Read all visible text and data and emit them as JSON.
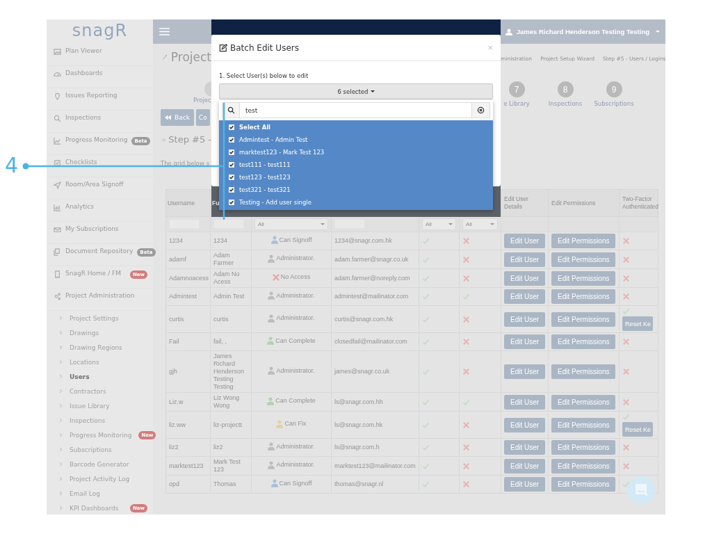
{
  "callout": {
    "label": "4"
  },
  "sidebar": {
    "logo": "snagR",
    "items": [
      {
        "label": "Plan Viewer"
      },
      {
        "label": "Dashboards"
      },
      {
        "label": "Issues Reporting"
      },
      {
        "label": "Inspections"
      },
      {
        "label": "Progress Monitoring",
        "badge": {
          "text": "Beta",
          "color": "#9c9c9c"
        }
      },
      {
        "label": "Checklists"
      },
      {
        "label": "Room/Area Signoff"
      },
      {
        "label": "Analytics"
      },
      {
        "label": "My Subscriptions"
      },
      {
        "label": "Document Repository",
        "badge": {
          "text": "Beta",
          "color": "#9c9c9c"
        }
      },
      {
        "label": "SnagR Home / FM",
        "badge": {
          "text": "New",
          "color": "#d27c7c"
        }
      },
      {
        "label": "Project Administration",
        "children": [
          {
            "label": "Project Settings",
            "selected": false
          },
          {
            "label": "Drawings",
            "selected": false
          },
          {
            "label": "Drawing Regions",
            "selected": false
          },
          {
            "label": "Locations",
            "selected": false
          },
          {
            "label": "Users",
            "selected": true
          },
          {
            "label": "Contractors",
            "selected": false
          },
          {
            "label": "Issue Library",
            "selected": false
          },
          {
            "label": "Inspections",
            "selected": false
          },
          {
            "label": "Progress Monitoring",
            "selected": false,
            "badge": {
              "text": "New",
              "color": "#d27c7c"
            }
          },
          {
            "label": "Subscriptions",
            "selected": false
          },
          {
            "label": "Barcode Generator",
            "selected": false
          },
          {
            "label": "Project Activity Log",
            "selected": false
          },
          {
            "label": "Email Log",
            "selected": false
          },
          {
            "label": "KPI Dashboards",
            "selected": false,
            "badge": {
              "text": "New",
              "color": "#d27c7c"
            }
          }
        ]
      }
    ]
  },
  "topbar": {
    "user": "James Richard Henderson Testing Testing"
  },
  "page": {
    "title": "Project",
    "breadcrumb": [
      "ministration",
      "Project Setup Wizard",
      "Step #5 - Users / Logins"
    ],
    "left_step_label": "Projec",
    "wizard_steps": [
      {
        "number": "7",
        "label": "e Library"
      },
      {
        "number": "8",
        "label": "Inspections"
      },
      {
        "number": "9",
        "label": "Subscriptions"
      }
    ],
    "buttons": [
      "Back",
      "Co"
    ],
    "step_heading": "Step #5 -",
    "intro": "The grid below s"
  },
  "table": {
    "header_left": [
      "Username",
      "Fu"
    ],
    "header_right": [
      "Edit User Details",
      "Edit Permissions",
      "Two-Factor Authenticated"
    ],
    "filters": [
      {
        "kind": "text"
      },
      {
        "kind": "text"
      },
      {
        "kind": "select",
        "value": "All"
      },
      {
        "kind": "text"
      },
      {
        "kind": "select",
        "value": "All"
      },
      {
        "kind": "select",
        "value": "All"
      }
    ],
    "rows": [
      {
        "username": "1234",
        "full_name": "1234",
        "role": {
          "label": "Can Signoff",
          "kind": "signoff"
        },
        "email": "1234@snagr.com.hk",
        "column_5": true,
        "column_6": false,
        "edit_user": "Edit User",
        "edit_permissions": "Edit Permissions",
        "two_factor": false
      },
      {
        "username": "adamf",
        "full_name": "Adam Farmer",
        "role": {
          "label": "Administrator.",
          "kind": "admin"
        },
        "email": "adam.farmer@snagr.co.uk",
        "column_5": true,
        "column_6": false,
        "edit_user": "Edit User",
        "edit_permissions": "Edit Permissions",
        "two_factor": false
      },
      {
        "username": "Adamnoacess",
        "full_name": "Adam No Acess",
        "role": {
          "label": "No Access",
          "kind": "none"
        },
        "email": "adam.farmer@noreply.com",
        "column_5": true,
        "column_6": false,
        "edit_user": "Edit User",
        "edit_permissions": "Edit Permissions",
        "two_factor": false
      },
      {
        "username": "Admintest",
        "full_name": "Admin Test",
        "role": {
          "label": "Administrator.",
          "kind": "admin"
        },
        "email": "admintest@mailinator.com",
        "column_5": true,
        "column_6": true,
        "edit_user": "Edit User",
        "edit_permissions": "Edit Permissions",
        "two_factor": false
      },
      {
        "username": "curtis",
        "full_name": "curtis",
        "role": {
          "label": "Administrator.",
          "kind": "admin"
        },
        "email": "curtis@snagr.com.hk",
        "column_5": true,
        "column_6": false,
        "edit_user": "Edit User",
        "edit_permissions": "Edit Permissions",
        "two_factor": true,
        "reset": "Reset Ke"
      },
      {
        "username": "Fail",
        "full_name": "fail, ,",
        "role": {
          "label": "Can Complete",
          "kind": "complete"
        },
        "email": "closedfail@mailinator.com",
        "column_5": true,
        "column_6": false,
        "edit_user": "Edit User",
        "edit_permissions": "Edit Permissions",
        "two_factor": false
      },
      {
        "username": "gjh",
        "full_name": "James Richard Henderson Testing Testing",
        "role": {
          "label": "Administrator.",
          "kind": "admin"
        },
        "email": "james@snagr.co.uk",
        "column_5": true,
        "column_6": false,
        "edit_user": "Edit User",
        "edit_permissions": "Edit Permissions",
        "two_factor": false
      },
      {
        "username": "Liz.w",
        "full_name": "Liz Wong Wong",
        "role": {
          "label": "Can Complete",
          "kind": "complete"
        },
        "email": "ls@snagr.com.hh",
        "column_5": true,
        "column_6": true,
        "edit_user": "Edit User",
        "edit_permissions": "Edit Permissions",
        "two_factor": false
      },
      {
        "username": "liz.ww",
        "full_name": "liz-projectt",
        "role": {
          "label": "Can Fix",
          "kind": "fix"
        },
        "email": "ls@snagr.com.hk",
        "column_5": true,
        "column_6": false,
        "edit_user": "Edit User",
        "edit_permissions": "Edit Permissions",
        "two_factor": true,
        "reset": "Reset Ke"
      },
      {
        "username": "liz2",
        "full_name": "liz2",
        "role": {
          "label": "Administrator.",
          "kind": "admin"
        },
        "email": "ls@snagr.com.h",
        "column_5": true,
        "column_6": false,
        "edit_user": "Edit User",
        "edit_permissions": "Edit Permissions",
        "two_factor": false
      },
      {
        "username": "marktest123",
        "full_name": "Mark Test 123",
        "role": {
          "label": "Administrator.",
          "kind": "admin"
        },
        "email": "marktest123@mailinator.com",
        "column_5": true,
        "column_6": false,
        "edit_user": "Edit User",
        "edit_permissions": "Edit Permissions",
        "two_factor": false
      },
      {
        "username": "opd",
        "full_name": "Thomas",
        "role": {
          "label": "Can Signoff",
          "kind": "signoff"
        },
        "email": "thomas@snagr.nl",
        "column_5": true,
        "column_6": false,
        "edit_user": "Edit User",
        "edit_permissions": "Edit Permissions",
        "two_factor": true
      }
    ]
  },
  "modal": {
    "title": "Batch Edit Users",
    "close": "×",
    "step_label": "1. Select User(s) below to edit",
    "dropdown": {
      "value": "6 selected",
      "search": "test",
      "options": [
        {
          "label": "Select All",
          "kind": "select_all",
          "checked": true
        },
        {
          "label": "Admintest - Admin Test",
          "kind": "user",
          "checked": true
        },
        {
          "label": "marktest123 - Mark Test 123",
          "kind": "user",
          "checked": true
        },
        {
          "label": "test111 - test111",
          "kind": "user",
          "checked": true
        },
        {
          "label": "test123 - test123",
          "kind": "user",
          "checked": true
        },
        {
          "label": "test321 - test321",
          "kind": "user",
          "checked": true
        },
        {
          "label": "Testing - Add user single",
          "kind": "user",
          "checked": true
        }
      ]
    }
  }
}
